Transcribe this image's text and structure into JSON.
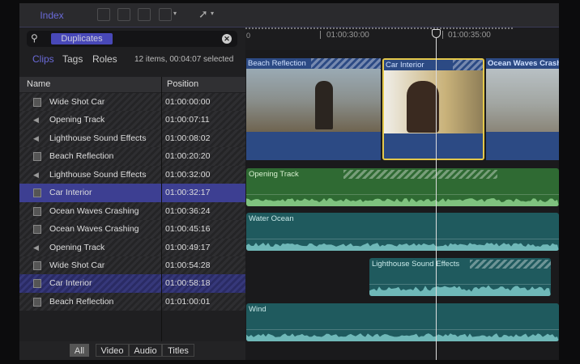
{
  "toolbar": {
    "index_label": "Index",
    "icons": [
      "append-clip-icon",
      "insert-clip-icon",
      "connect-clip-icon",
      "overwrite-clip-icon",
      "select-tool-icon"
    ]
  },
  "search": {
    "token": "Duplicates"
  },
  "tabs": {
    "clips": "Clips",
    "tags": "Tags",
    "roles": "Roles",
    "summary": "12 items, 00:04:07 selected"
  },
  "columns": {
    "name": "Name",
    "position": "Position"
  },
  "rows": [
    {
      "type": "video",
      "name": "Wide Shot Car",
      "position": "01:00:00:00"
    },
    {
      "type": "audio",
      "name": "Opening Track",
      "position": "01:00:07:11"
    },
    {
      "type": "audio",
      "name": "Lighthouse Sound Effects",
      "position": "01:00:08:02"
    },
    {
      "type": "video",
      "name": "Beach Reflection",
      "position": "01:00:20:20"
    },
    {
      "type": "audio",
      "name": "Lighthouse Sound Effects",
      "position": "01:00:32:00"
    },
    {
      "type": "video",
      "name": "Car Interior",
      "position": "01:00:32:17",
      "state": "selected"
    },
    {
      "type": "video",
      "name": "Ocean Waves Crashing",
      "position": "01:00:36:24"
    },
    {
      "type": "video",
      "name": "Ocean Waves Crashing",
      "position": "01:00:45:16"
    },
    {
      "type": "audio",
      "name": "Opening Track",
      "position": "01:00:49:17"
    },
    {
      "type": "video",
      "name": "Wide Shot Car",
      "position": "01:00:54:28"
    },
    {
      "type": "video",
      "name": "Car Interior",
      "position": "01:00:58:18",
      "state": "highlighted"
    },
    {
      "type": "video",
      "name": "Beach Reflection",
      "position": "01:01:00:01"
    }
  ],
  "filters": {
    "all": "All",
    "video": "Video",
    "audio": "Audio",
    "titles": "Titles",
    "active": "All"
  },
  "ruler": {
    "start": "0",
    "t1": "01:00:30:00",
    "t2": "01:00:35:00"
  },
  "timeline": {
    "video_clips": [
      {
        "name": "Beach Reflection"
      },
      {
        "name": "Car Interior",
        "selected": true
      },
      {
        "name": "Ocean Waves Crash"
      }
    ],
    "audio_clips": [
      {
        "name": "Opening Track",
        "color": "#2f6a33"
      },
      {
        "name": "Water Ocean",
        "color": "#1f5a5e"
      },
      {
        "name": "Lighthouse Sound Effects",
        "color": "#1f5a5e"
      },
      {
        "name": "Wind",
        "color": "#1f5a5e"
      }
    ]
  }
}
